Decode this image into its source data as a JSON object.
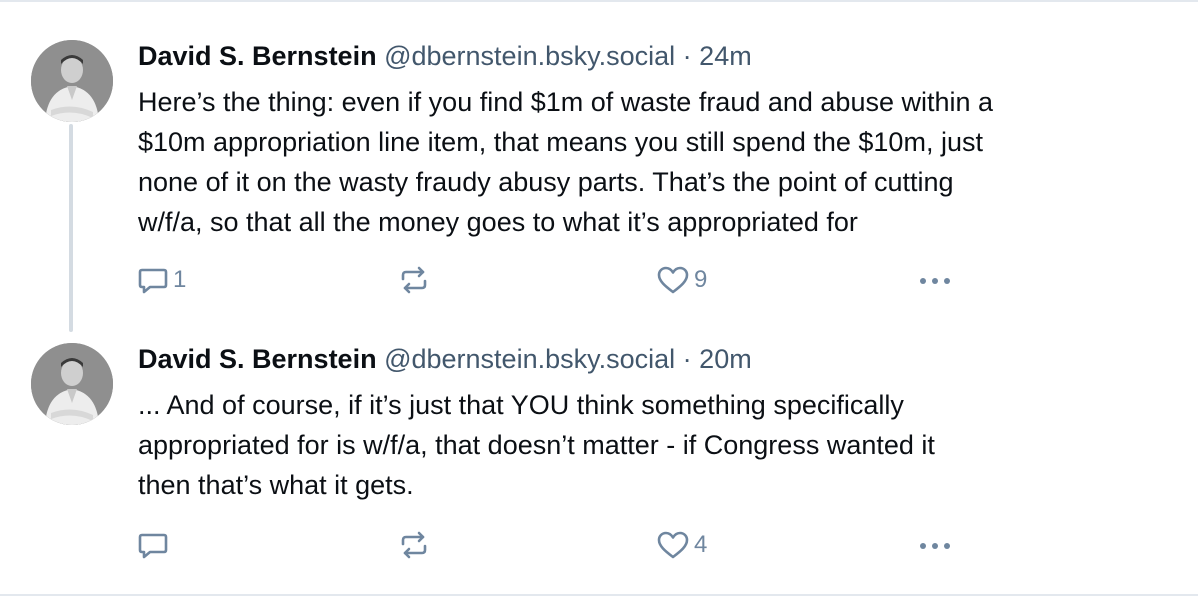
{
  "posts": [
    {
      "author": "David S. Bernstein",
      "handle": "@dbernstein.bsky.social",
      "separator": "·",
      "time": "24m",
      "text": "Here’s the thing: even if you find $1m of waste fraud and abuse within a\n$10m appropriation line item, that means you still spend the $10m, just\nnone of it on the wasty fraudy abusy parts. That’s the point of cutting\nw/f/a, so that all the money goes to what it’s appropriated for",
      "reply_count": "1",
      "repost_count": "",
      "like_count": "9"
    },
    {
      "author": "David S. Bernstein",
      "handle": "@dbernstein.bsky.social",
      "separator": "·",
      "time": "20m",
      "text": "... And of course, if it’s just that YOU think something specifically\nappropriated for is w/f/a, that doesn’t matter - if Congress wanted it\nthen that’s what it gets.",
      "reply_count": "",
      "repost_count": "",
      "like_count": "4"
    }
  ],
  "icons": {
    "reply": "reply-icon",
    "repost": "repost-icon",
    "like": "heart-icon",
    "more": "more-icon"
  },
  "colors": {
    "text": "#0b0f14",
    "secondary": "#42576c",
    "icon": "#6f869f",
    "thread_line": "#d4dbe2",
    "divider": "#e3e8ee"
  }
}
